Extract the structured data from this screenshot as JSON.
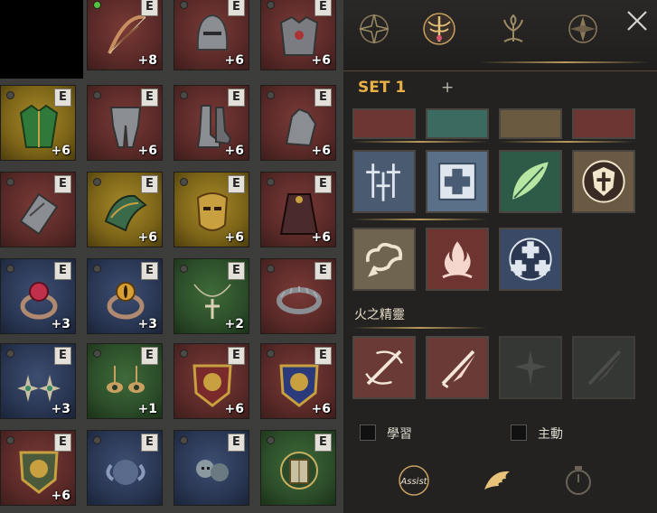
{
  "inventory": {
    "badge_label": "E",
    "slots": [
      {
        "item": "bow",
        "color": "red",
        "level": "+8",
        "dot": "green"
      },
      {
        "item": "helmet",
        "color": "red",
        "level": "+6",
        "dot": "gray"
      },
      {
        "item": "chest-armor",
        "color": "red",
        "level": "+6",
        "dot": "gray"
      },
      {
        "item": "tunic",
        "color": "gold",
        "level": "+6",
        "dot": "gray"
      },
      {
        "item": "leg-armor",
        "color": "red",
        "level": "+6",
        "dot": "gray"
      },
      {
        "item": "boots",
        "color": "red",
        "level": "+6",
        "dot": "gray"
      },
      {
        "item": "gauntlet",
        "color": "red",
        "level": "+6",
        "dot": "gray"
      },
      {
        "item": "bracer",
        "color": "red",
        "level": "",
        "dot": "gray"
      },
      {
        "item": "shoulder-guard",
        "color": "gold",
        "level": "+6",
        "dot": "gray"
      },
      {
        "item": "mask",
        "color": "gold",
        "level": "+6",
        "dot": "gray"
      },
      {
        "item": "cloak",
        "color": "red",
        "level": "+6",
        "dot": "gray"
      },
      {
        "item": "ruby-ring",
        "color": "blue",
        "level": "+3",
        "dot": "gray"
      },
      {
        "item": "amber-ring",
        "color": "blue",
        "level": "+3",
        "dot": "gray"
      },
      {
        "item": "cross-necklace",
        "color": "green",
        "level": "+2",
        "dot": "gray"
      },
      {
        "item": "spiked-belt",
        "color": "red",
        "level": "",
        "dot": "gray"
      },
      {
        "item": "star-earrings",
        "color": "blue",
        "level": "+3",
        "dot": "gray"
      },
      {
        "item": "eye-earrings",
        "color": "green",
        "level": "+1",
        "dot": "gray"
      },
      {
        "item": "lion-crest-red",
        "color": "red",
        "level": "+6",
        "dot": "gray"
      },
      {
        "item": "lion-crest-blue",
        "color": "red",
        "level": "+6",
        "dot": "gray"
      },
      {
        "item": "lion-crest-gold",
        "color": "red",
        "level": "+6",
        "dot": "gray"
      },
      {
        "item": "ram-emblem",
        "color": "blue",
        "level": "",
        "dot": "gray"
      },
      {
        "item": "skull-emblem",
        "color": "blue",
        "level": "",
        "dot": "gray"
      },
      {
        "item": "orb-tome",
        "color": "green",
        "level": "",
        "dot": "gray"
      }
    ]
  },
  "panel": {
    "tabs": [
      "compass-star-icon",
      "winged-sword-icon",
      "tree-emblem-icon",
      "compass-icon"
    ],
    "close_icon": "close-icon",
    "set_label": "SET 1",
    "add_set_label": "+",
    "section_title": "火之精靈",
    "learn_label": "學習",
    "active_label": "主動",
    "assist_label": "Assist",
    "bottom_icons": [
      "assist-icon",
      "wing-icon",
      "timer-icon"
    ]
  },
  "colors": {
    "accent_gold": "#e8b046",
    "panel_bg": "#232221"
  }
}
